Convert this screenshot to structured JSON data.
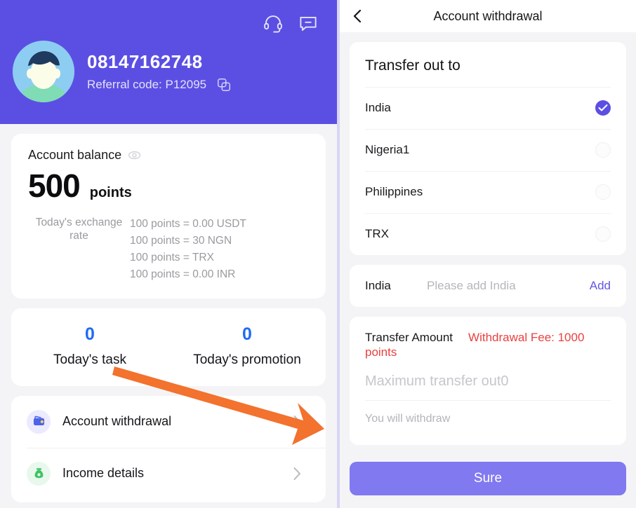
{
  "colors": {
    "brand_purple": "#5b4fe3",
    "button_purple": "#8179ef",
    "accent_blue": "#1f6bf5",
    "fee_red": "#e8413f",
    "annotation_orange": "#f2722e"
  },
  "left": {
    "header": {
      "phone": "08147162748",
      "referral_label": "Referral code: P12095",
      "support_icon": "headset-icon",
      "chat_icon": "chat-bubble-icon",
      "copy_icon": "copy-icon",
      "avatar_icon": "avatar"
    },
    "balance": {
      "title": "Account balance",
      "eye_icon": "eye-icon",
      "amount": "500",
      "unit": "points",
      "rate_label": "Today's exchange rate",
      "rates": [
        "100 points = 0.00 USDT",
        "100 points = 30 NGN",
        "100 points = TRX",
        "100 points = 0.00 INR"
      ]
    },
    "stats": [
      {
        "value": "0",
        "label": "Today's task"
      },
      {
        "value": "0",
        "label": "Today's promotion"
      }
    ],
    "menu": [
      {
        "label": "Account withdrawal",
        "icon": "wallet-icon",
        "chevron": "chevron-right-icon"
      },
      {
        "label": "Income details",
        "icon": "money-bag-icon",
        "chevron": "chevron-right-icon"
      }
    ],
    "annotation": {
      "type": "arrow",
      "points_to": "Account withdrawal"
    }
  },
  "right": {
    "topbar": {
      "title": "Account withdrawal",
      "back_icon": "chevron-left-icon"
    },
    "transfer": {
      "title": "Transfer out to",
      "options": [
        {
          "name": "India",
          "selected": true
        },
        {
          "name": "Nigeria1",
          "selected": false
        },
        {
          "name": "Philippines",
          "selected": false
        },
        {
          "name": "TRX",
          "selected": false
        }
      ]
    },
    "add_account": {
      "country": "India",
      "placeholder": "Please add India",
      "value": "",
      "add_label": "Add"
    },
    "amount": {
      "label": "Transfer Amount",
      "fee_label": "Withdrawal Fee:  1000",
      "fee_points": "points",
      "placeholder": "Maximum transfer out0",
      "value": "",
      "note": "You will withdraw"
    },
    "submit_label": "Sure"
  }
}
